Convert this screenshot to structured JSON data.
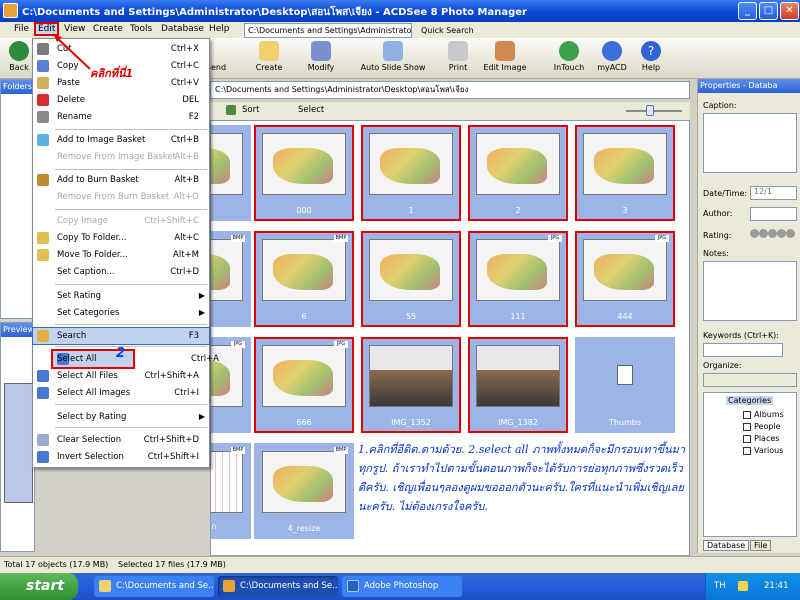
{
  "window": {
    "title": "C:\\Documents and Settings\\Administrator\\Desktop\\สอนโพส\\เจียง - ACDSee 8 Photo Manager",
    "min": "_",
    "max": "□",
    "close": "✕"
  },
  "menubar": {
    "items": [
      "File",
      "Edit",
      "View",
      "Create",
      "Tools",
      "Database",
      "Help"
    ],
    "path_combo": "C:\\Documents and Settings\\Administrator",
    "quick_search": "Quick Search"
  },
  "toolbar": {
    "back": "Back",
    "send": "Send",
    "create": "Create",
    "modify": "Modify",
    "slideshow": "Auto Slide Show",
    "print": "Print",
    "edit_image": "Edit Image",
    "intouch": "InTouch",
    "myacd": "myACD",
    "help": "Help"
  },
  "folders": {
    "title": "Folders"
  },
  "preview": {
    "title": "Preview"
  },
  "edit_menu": {
    "items": [
      {
        "label": "Cut",
        "shortcut": "Ctrl+X",
        "disabled": false
      },
      {
        "label": "Copy",
        "shortcut": "Ctrl+C",
        "disabled": false
      },
      {
        "label": "Paste",
        "shortcut": "Ctrl+V",
        "disabled": false
      },
      {
        "label": "Delete",
        "shortcut": "DEL",
        "disabled": false
      },
      {
        "label": "Rename",
        "shortcut": "F2",
        "disabled": false
      },
      {
        "label": "Add to Image Basket",
        "shortcut": "Ctrl+B",
        "disabled": false
      },
      {
        "label": "Remove From Image Basket",
        "shortcut": "Alt+B",
        "disabled": true
      },
      {
        "label": "Add to Burn Basket",
        "shortcut": "Alt+B",
        "disabled": false
      },
      {
        "label": "Remove From Burn Basket",
        "shortcut": "Alt+O",
        "disabled": true
      },
      {
        "label": "Copy Image",
        "shortcut": "Ctrl+Shift+C",
        "disabled": true
      },
      {
        "label": "Copy To Folder...",
        "shortcut": "Alt+C",
        "disabled": false
      },
      {
        "label": "Move To Folder...",
        "shortcut": "Alt+M",
        "disabled": false
      },
      {
        "label": "Set Caption...",
        "shortcut": "Ctrl+D",
        "disabled": false
      },
      {
        "label": "Set Rating",
        "shortcut": "",
        "disabled": false
      },
      {
        "label": "Set Categories",
        "shortcut": "",
        "disabled": false
      },
      {
        "label": "Search",
        "shortcut": "F3",
        "disabled": false
      },
      {
        "label": "Select All",
        "shortcut": "Ctrl+A",
        "disabled": false
      },
      {
        "label": "Select All Files",
        "shortcut": "Ctrl+Shift+A",
        "disabled": false
      },
      {
        "label": "Select All Images",
        "shortcut": "Ctrl+I",
        "disabled": false
      },
      {
        "label": "Select by Rating",
        "shortcut": "",
        "disabled": false
      },
      {
        "label": "Clear Selection",
        "shortcut": "Ctrl+Shift+D",
        "disabled": false
      },
      {
        "label": "Invert Selection",
        "shortcut": "Ctrl+Shift+I",
        "disabled": false
      }
    ]
  },
  "annotations": {
    "step1": "คลิกที่นี่1",
    "step2": "2",
    "note": "1.คลิกที่อีดิต.ตามด้วย. 2.select all ภาพทั้งหมดก็จะมีกรอบเทาขึ้นมาทุกรูป. ถ้าเราทำไปตามขั้นตอนภาพก็จะได้รับการย่อทุกภาพซึ่งรวดเร็วดีครับ. เชิญเพื่อนๆลองดูผมขอออกตัวนะครับ.ใครที่แนะนำเพิ่มเชิญเลยนะครับ. ไม่ต้องเกรงใจครับ."
  },
  "address": "C:\\Documents and Settings\\Administrator\\Desktop\\สอนโพส\\เจียง",
  "view_toolbar": {
    "sort": "Sort",
    "select": "Select"
  },
  "thumbnails": [
    {
      "name": "",
      "kind": "screen",
      "badge": "",
      "red": false
    },
    {
      "name": "000",
      "kind": "screen",
      "badge": "",
      "red": true
    },
    {
      "name": "1",
      "kind": "screen",
      "badge": "",
      "red": true
    },
    {
      "name": "2",
      "kind": "screen",
      "badge": "",
      "red": true
    },
    {
      "name": "3",
      "kind": "screen",
      "badge": "",
      "red": true
    },
    {
      "name": "",
      "kind": "screen",
      "badge": "BMP",
      "red": false
    },
    {
      "name": "6",
      "kind": "screen",
      "badge": "BMP",
      "red": true
    },
    {
      "name": "55",
      "kind": "screen",
      "badge": "",
      "red": true
    },
    {
      "name": "111",
      "kind": "screen",
      "badge": "JPG",
      "red": true
    },
    {
      "name": "444",
      "kind": "screen",
      "badge": "JPG",
      "red": true
    },
    {
      "name": "",
      "kind": "screen",
      "badge": "JPG",
      "red": false
    },
    {
      "name": "666",
      "kind": "screen",
      "badge": "JPG",
      "red": true
    },
    {
      "name": "IMG_1352",
      "kind": "photo",
      "badge": "",
      "red": true
    },
    {
      "name": "IMG_1382",
      "kind": "photo",
      "badge": "",
      "red": true
    },
    {
      "name": "Thumbs",
      "kind": "file",
      "badge": "",
      "red": false
    },
    {
      "name": "จะให้เล็ก",
      "kind": "plan",
      "badge": "BMP",
      "red": false
    },
    {
      "name": "4_resize",
      "kind": "screen",
      "badge": "BMP",
      "red": false
    }
  ],
  "properties": {
    "title": "Properties - Databa",
    "caption": "Caption:",
    "datetime": "Date/Time:",
    "date_value": "12/1",
    "author": "Author:",
    "rating": "Rating:",
    "notes": "Notes:",
    "keywords": "Keywords (Ctrl+K):",
    "organize": "Organize:",
    "categories": "Categories",
    "cat_items": [
      "Albums",
      "People",
      "Places",
      "Various"
    ],
    "tab_database": "Database",
    "tab_file": "File"
  },
  "status": {
    "total": "Total 17 objects (17.9 MB)",
    "selected": "Selected 17 files (17.9 MB)"
  },
  "taskbar": {
    "start": "start",
    "tasks": [
      "C:\\Documents and Se...",
      "C:\\Documents and Se...",
      "Adobe Photoshop"
    ],
    "lang": "TH",
    "time": "21:41"
  }
}
